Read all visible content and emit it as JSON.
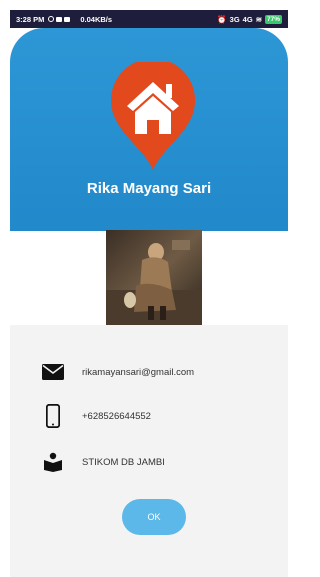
{
  "status_bar": {
    "time": "3:28 PM",
    "network_speed": "0.04KB/s",
    "signal": "3G",
    "signal2": "4G",
    "battery": "77%"
  },
  "profile": {
    "name": "Rika Mayang Sari",
    "pin_icon": "home-location-pin"
  },
  "contacts": [
    {
      "icon": "mail-icon",
      "value": "rikamayansari@gmail.com"
    },
    {
      "icon": "phone-icon",
      "value": "+628526644552"
    },
    {
      "icon": "school-icon",
      "value": "STIKOM DB JAMBI"
    }
  ],
  "actions": {
    "ok_label": "OK"
  },
  "colors": {
    "header": "#2d97d6",
    "pin": "#e2491c",
    "ok_button": "#5bb8e9",
    "card": "#f3f3f3"
  }
}
